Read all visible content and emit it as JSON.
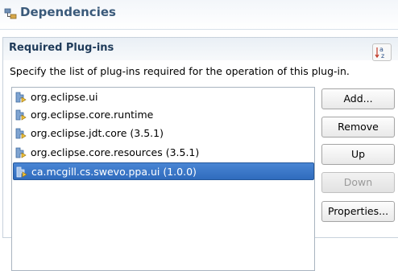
{
  "header": {
    "title": "Dependencies",
    "icon": "dependencies-icon"
  },
  "section": {
    "title": "Required Plug-ins",
    "sort_icon": "sort-alphabetical-icon",
    "description": "Specify the list of plug-ins required for the operation of this plug-in."
  },
  "plugins": [
    {
      "label": "org.eclipse.ui",
      "icon": "plugin-icon"
    },
    {
      "label": "org.eclipse.core.runtime",
      "icon": "plugin-icon"
    },
    {
      "label": "org.eclipse.jdt.core (3.5.1)",
      "icon": "plugin-icon"
    },
    {
      "label": "org.eclipse.core.resources (3.5.1)",
      "icon": "plugin-icon"
    },
    {
      "label": "ca.mcgill.cs.swevo.ppa.ui (1.0.0)",
      "icon": "plugin-icon",
      "selected": true
    }
  ],
  "buttons": {
    "add": "Add...",
    "remove": "Remove",
    "up": "Up",
    "down": "Down",
    "properties": "Properties..."
  },
  "colors": {
    "header_title": "#3a5a7a",
    "section_title": "#1f3b5a",
    "selection": "#3a78c8"
  }
}
